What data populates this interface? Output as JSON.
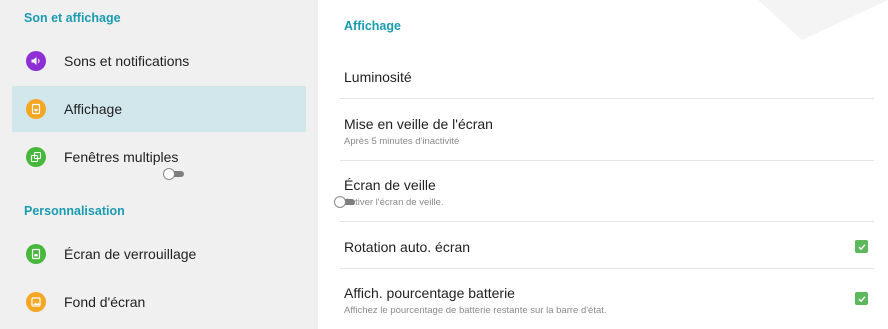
{
  "sidebar": {
    "sections": [
      {
        "header": "Son et affichage"
      },
      {
        "header": "Personnalisation"
      }
    ],
    "items": [
      {
        "label": "Sons et notifications",
        "icon": "speaker-icon",
        "color": "#8e2fd6"
      },
      {
        "label": "Affichage",
        "icon": "display-icon",
        "color": "#f5a623",
        "selected": true
      },
      {
        "label": "Fenêtres multiples",
        "icon": "multi-window-icon",
        "color": "#47b83b",
        "toggle": false
      },
      {
        "label": "Écran de verrouillage",
        "icon": "lock-screen-icon",
        "color": "#47b83b"
      },
      {
        "label": "Fond d'écran",
        "icon": "wallpaper-icon",
        "color": "#f5a623"
      }
    ]
  },
  "main": {
    "header": "Affichage",
    "rows": [
      {
        "title": "Luminosité"
      },
      {
        "title": "Mise en veille de l'écran",
        "subtitle": "Après 5 minutes d'inactivité"
      },
      {
        "title": "Écran de veille",
        "subtitle": "Activer l'écran de veille.",
        "toggle": false
      },
      {
        "title": "Rotation auto. écran",
        "checked": true
      },
      {
        "title": "Affich. pourcentage batterie",
        "subtitle": "Affichez le pourcentage de batterie restante sur la barre d'état.",
        "checked": true
      }
    ]
  },
  "colors": {
    "accent": "#1a9bb2",
    "selected_bg": "#d2e7ec",
    "check": "#5cb85c"
  }
}
